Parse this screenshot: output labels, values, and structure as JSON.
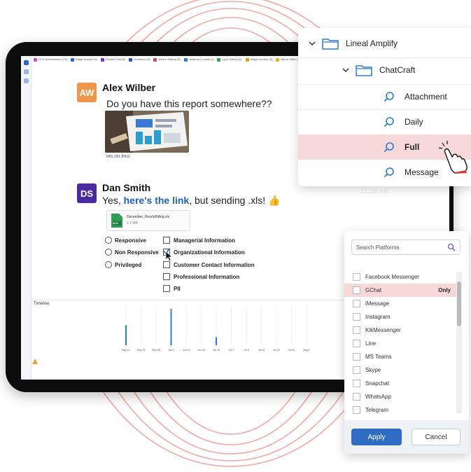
{
  "colors": {
    "ring": "#f0a8a8",
    "accent_blue": "#1b5fc8",
    "apply_blue": "#2f6dc4",
    "selection_pink": "#f6d8d8",
    "avatar_aw": "#f0964a",
    "avatar_ds": "#4b2aa0",
    "timeline_bar": "#2b7bd6"
  },
  "tag_bar": {
    "tags": [
      {
        "label": "HCD Administrator (74)",
        "color": "#c94fd0"
      },
      {
        "label": "Wage Answer (6)",
        "color": "#2e66d6"
      },
      {
        "label": "Private Chat (8)",
        "color": "#6a3ad0"
      },
      {
        "label": "Violations (6)",
        "color": "#2f4ed6"
      },
      {
        "label": "Where Gallery (6)",
        "color": "#d14a5b"
      },
      {
        "label": "Johanna Lovana (7)",
        "color": "#2e7dd6"
      },
      {
        "label": "Lynn Gallery (5)",
        "color": "#3aa24c"
      },
      {
        "label": "Image Section (5)",
        "color": "#e0a21e"
      },
      {
        "label": "Name Wilks (1)",
        "color": "#e0b81e"
      }
    ]
  },
  "messages": [
    {
      "initials": "AW",
      "sender": "Alex Wilber",
      "text": "Do you have this report somewhere??",
      "attachment": "IMG.200.JPEG"
    },
    {
      "initials": "DS",
      "sender": "Dan Smith",
      "text_before": "Yes, ",
      "link": "here's the link",
      "text_after": ", but sending .xls! 👍",
      "file": {
        "name": "December_HourlyBilling.xls",
        "size": "2.2 MB",
        "type": "XLS"
      }
    }
  ],
  "responsiveness": [
    "Responsive",
    "Non Responsive",
    "Privileged"
  ],
  "categories": [
    {
      "label": "Managerial Information",
      "checked": false
    },
    {
      "label": "Organizational Information",
      "checked": true
    },
    {
      "label": "Customer Contact Information",
      "checked": false
    },
    {
      "label": "Professional Information",
      "checked": false
    },
    {
      "label": "PII",
      "checked": false
    }
  ],
  "timeline": {
    "title": "Timeline",
    "dates": [
      "May 14",
      "May 21",
      "May 28",
      "Jun 4",
      "Jun 11",
      "Jun 18",
      "Jun 25",
      "Jul 2",
      "Jul 9",
      "Jul 16",
      "Jul 23",
      "Jul 30",
      "Aug 6"
    ],
    "bars": [
      {
        "date_index": 0,
        "level": 0.55
      },
      {
        "date_index": 3,
        "level": 1.0
      },
      {
        "date_index": 6,
        "level": 0.22
      }
    ]
  },
  "folder_tree": {
    "root": "Lineal Amplify",
    "child": "ChatCraft",
    "searches": [
      {
        "label": "Attachment",
        "selected": false
      },
      {
        "label": "Daily",
        "selected": false
      },
      {
        "label": "Full",
        "selected": true
      },
      {
        "label": "Message",
        "selected": false
      }
    ]
  },
  "time_stamp": "11:28 AM",
  "platforms": {
    "search_placeholder": "Search Platforms",
    "items": [
      {
        "label": "Facebook Messenger",
        "selected": false
      },
      {
        "label": "GChat",
        "selected": true
      },
      {
        "label": "iMessage",
        "selected": false
      },
      {
        "label": "Instagram",
        "selected": false
      },
      {
        "label": "KikMessenger",
        "selected": false
      },
      {
        "label": "Line",
        "selected": false
      },
      {
        "label": "MS Teams",
        "selected": false
      },
      {
        "label": "Skype",
        "selected": false
      },
      {
        "label": "Snapchat",
        "selected": false
      },
      {
        "label": "WhatsApp",
        "selected": false
      },
      {
        "label": "Telegram",
        "selected": false
      }
    ],
    "only_label": "Only",
    "apply_label": "Apply",
    "cancel_label": "Cancel"
  }
}
